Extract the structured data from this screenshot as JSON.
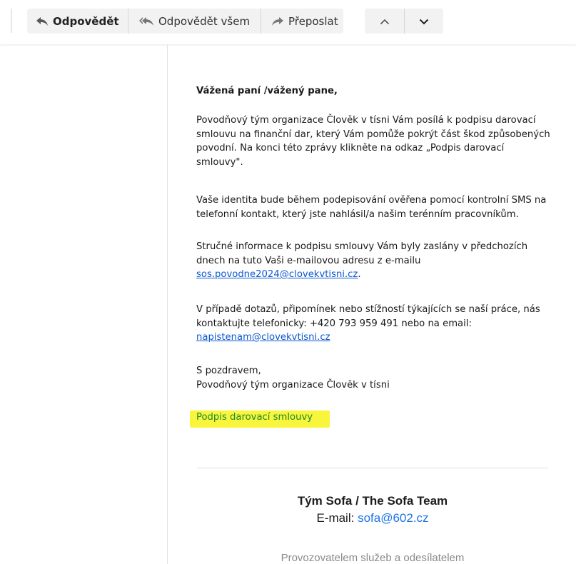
{
  "toolbar": {
    "reply_label": "Odpovědět",
    "reply_all_label": "Odpovědět všem",
    "forward_label": "Přeposlat",
    "reply_icon": "reply-icon",
    "reply_all_icon": "reply-all-icon",
    "forward_icon": "forward-icon",
    "prev_icon": "chevron-up-icon",
    "next_icon": "chevron-down-icon"
  },
  "email": {
    "greeting": "Vážená paní /vážený pane,",
    "paragraph1": "Povodňový tým organizace Člověk v tísni Vám posílá k podpisu darovací smlouvu na finanční dar, který Vám pomůže pokrýt část škod způsobených povodní. Na konci této zprávy klikněte na odkaz „Podpis darovací smlouvy\".",
    "paragraph2": "Vaše identita bude během podepisování ověřena pomocí kontrolní SMS na telefonní kontakt, který jste nahlásil/a našim terénním pracovníkům.",
    "paragraph3_text": "Stručné informace k podpisu smlouvy Vám byly zaslány v předchozích dnech na tuto Vaši e-mailovou adresu z e-mailu",
    "paragraph3_link": "sos.povodne2024@clovekvtisni.cz",
    "paragraph3_end": ".",
    "paragraph4_text": "V případě dotazů, připomínek nebo stížností týkajících se naší práce, nás kontaktujte telefonicky: +420 793 959 491 nebo na email:",
    "paragraph4_link": "napistenam@clovekvtisni.cz",
    "closing1": "S pozdravem,",
    "closing2": "Povodňový tým organizace Člověk v tísni",
    "sign_link": "Podpis darovací smlouvy"
  },
  "footer": {
    "team_name": "Tým Sofa / The Sofa Team",
    "email_label": "E-mail: ",
    "email_value": "sofa@602.cz",
    "provider_text": "Provozovatelem služeb a odesílatelem"
  },
  "colors": {
    "link": "#0b57d0",
    "highlight": "#f9f53a",
    "sign_link_text": "#1a8a34",
    "footer_email": "#1a73e8"
  }
}
